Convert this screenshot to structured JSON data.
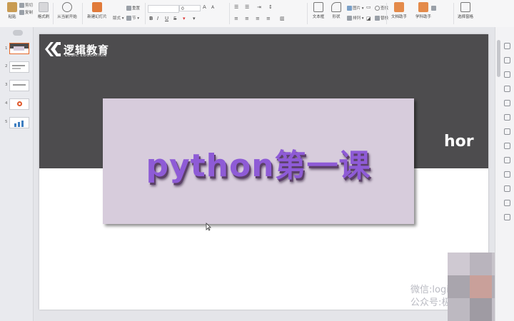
{
  "ribbon": {
    "paste": "粘贴",
    "cut": "剪切",
    "copy": "复制",
    "format_painter": "格式刷",
    "from_current": "从当前开始",
    "new_slide": "新建幻灯片",
    "layout": "版式",
    "reset": "重置",
    "section": "节",
    "font_size": "0",
    "textbox": "文本框",
    "shape": "形状",
    "image": "图片",
    "arrange": "排列",
    "replace": "替换",
    "find": "查找",
    "doc_helper": "文档助手",
    "academic_helper": "学科助手",
    "select_pane": "选择窗格",
    "bold": "B",
    "italic": "I",
    "underline": "U",
    "strike": "S",
    "grow": "A",
    "shrink": "A"
  },
  "thumbnails": [
    {
      "num": "1"
    },
    {
      "num": "2"
    },
    {
      "num": "3"
    },
    {
      "num": "4"
    },
    {
      "num": "5"
    }
  ],
  "slide": {
    "logo_cn": "逻辑教育",
    "logo_en": "LOGIC EDUCATION",
    "partial_title": "hor",
    "overlay_title": "python第一课",
    "watermark_1": "微信:logic",
    "watermark_2": "公众号:极"
  },
  "colors": {
    "slide_header": "#4d4c4e",
    "overlay_bg": "#d7ccdc",
    "overlay_text": "#8e5bd6",
    "selected_thumb": "#e66b2c"
  }
}
